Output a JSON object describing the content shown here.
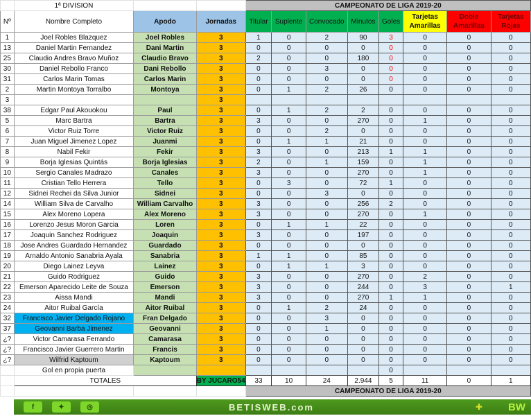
{
  "header": {
    "division": "1ª DIVISION",
    "campeonato": "CAMPEONATO  DE LIGA 2019-20"
  },
  "columns": {
    "no": "Nº",
    "nombre": "Nombre Completo",
    "apodo": "Apodo",
    "jornadas": "Jornadas",
    "titular": "Titular",
    "suplente": "Suplente",
    "convocado": "Convocado",
    "minutos": "Minutos",
    "goles": "Goles",
    "amarillas": "Tarjetas Amarillas",
    "doble": "Doble Amarillas",
    "rojas": "Tarjetas Rojas"
  },
  "players": [
    {
      "no": "1",
      "nombre": "Joel Robles Blazquez",
      "apodo": "Joel Robles",
      "jornadas": "3",
      "stats": [
        "1",
        "0",
        "2",
        "90",
        "3",
        "0",
        "0",
        "0"
      ],
      "goal_red": true
    },
    {
      "no": "13",
      "nombre": "Daniel Martin Fernandez",
      "apodo": "Dani Martin",
      "jornadas": "3",
      "stats": [
        "0",
        "0",
        "0",
        "0",
        "0",
        "0",
        "0",
        "0"
      ],
      "goal_red": true
    },
    {
      "no": "25",
      "nombre": "Claudio Andres Bravo Muñoz",
      "apodo": "Claudio Bravo",
      "jornadas": "3",
      "stats": [
        "2",
        "0",
        "0",
        "180",
        "0",
        "0",
        "0",
        "0"
      ],
      "goal_red": true
    },
    {
      "no": "30",
      "nombre": "Daniel Rebollo Franco",
      "apodo": "Dani  Rebollo",
      "jornadas": "3",
      "stats": [
        "0",
        "0",
        "3",
        "0",
        "0",
        "0",
        "0",
        "0"
      ],
      "goal_red": true
    },
    {
      "no": "31",
      "nombre": "Carlos Marin Tomas",
      "apodo": "Carlos Marin",
      "jornadas": "3",
      "stats": [
        "0",
        "0",
        "0",
        "0",
        "0",
        "0",
        "0",
        "0"
      ],
      "goal_red": true
    },
    {
      "no": "2",
      "nombre": "Martin Montoya Torralbo",
      "apodo": "Montoya",
      "jornadas": "3",
      "stats": [
        "0",
        "1",
        "2",
        "26",
        "0",
        "0",
        "0",
        "0"
      ]
    },
    {
      "no": "3",
      "nombre": "",
      "apodo": "",
      "jornadas": "3",
      "stats": [
        "",
        "",
        "",
        "",
        "",
        "",
        "",
        ""
      ]
    },
    {
      "no": "38",
      "nombre": "Edgar Paul Akouokou",
      "apodo": "Paul",
      "jornadas": "3",
      "stats": [
        "0",
        "1",
        "2",
        "2",
        "0",
        "0",
        "0",
        "0"
      ]
    },
    {
      "no": "5",
      "nombre": "Marc Bartra",
      "apodo": "Bartra",
      "jornadas": "3",
      "stats": [
        "3",
        "0",
        "0",
        "270",
        "0",
        "1",
        "0",
        "0"
      ]
    },
    {
      "no": "6",
      "nombre": "Victor Ruiz Torre",
      "apodo": "Victor Ruiz",
      "jornadas": "3",
      "stats": [
        "0",
        "0",
        "2",
        "0",
        "0",
        "0",
        "0",
        "0"
      ]
    },
    {
      "no": "7",
      "nombre": "Juan Miguel Jimenez Lopez",
      "apodo": "Juanmi",
      "jornadas": "3",
      "stats": [
        "0",
        "1",
        "1",
        "21",
        "0",
        "0",
        "0",
        "0"
      ]
    },
    {
      "no": "8",
      "nombre": "Nabil Fekir",
      "apodo": "Fekir",
      "jornadas": "3",
      "stats": [
        "3",
        "0",
        "0",
        "213",
        "1",
        "1",
        "0",
        "0"
      ]
    },
    {
      "no": "9",
      "nombre": "Borja Iglesias Quintás",
      "apodo": "Borja Iglesias",
      "jornadas": "3",
      "stats": [
        "2",
        "0",
        "1",
        "159",
        "0",
        "1",
        "0",
        "0"
      ]
    },
    {
      "no": "10",
      "nombre": "Sergio Canales Madrazo",
      "apodo": "Canales",
      "jornadas": "3",
      "stats": [
        "3",
        "0",
        "0",
        "270",
        "0",
        "1",
        "0",
        "0"
      ]
    },
    {
      "no": "11",
      "nombre": "Cristian Tello Herrera",
      "apodo": "Tello",
      "jornadas": "3",
      "stats": [
        "0",
        "3",
        "0",
        "72",
        "1",
        "0",
        "0",
        "0"
      ]
    },
    {
      "no": "12",
      "nombre": "Sidnei Rechei da Silva Junior",
      "apodo": "Sidnei",
      "jornadas": "3",
      "stats": [
        "0",
        "0",
        "3",
        "0",
        "0",
        "0",
        "0",
        "0"
      ]
    },
    {
      "no": "14",
      "nombre": "William Silva de Carvalho",
      "apodo": "William Carvalho",
      "jornadas": "3",
      "stats": [
        "3",
        "0",
        "0",
        "256",
        "2",
        "0",
        "0",
        "0"
      ]
    },
    {
      "no": "15",
      "nombre": "Alex Moreno Lopera",
      "apodo": "Alex Moreno",
      "jornadas": "3",
      "stats": [
        "3",
        "0",
        "0",
        "270",
        "0",
        "1",
        "0",
        "0"
      ]
    },
    {
      "no": "16",
      "nombre": "Lorenzo Jesus Moron Garcia",
      "apodo": "Loren",
      "jornadas": "3",
      "stats": [
        "0",
        "1",
        "1",
        "22",
        "0",
        "0",
        "0",
        "0"
      ]
    },
    {
      "no": "17",
      "nombre": "Joaquin Sanchez Rodriguez",
      "apodo": "Joaquin",
      "jornadas": "3",
      "stats": [
        "3",
        "0",
        "0",
        "197",
        "0",
        "0",
        "0",
        "0"
      ]
    },
    {
      "no": "18",
      "nombre": "Jose Andres Guardado Hernandez",
      "apodo": "Guardado",
      "jornadas": "3",
      "stats": [
        "0",
        "0",
        "0",
        "0",
        "0",
        "0",
        "0",
        "0"
      ]
    },
    {
      "no": "19",
      "nombre": "Arnaldo Antonio Sanabria Ayala",
      "apodo": "Sanabria",
      "jornadas": "3",
      "stats": [
        "1",
        "1",
        "0",
        "85",
        "0",
        "0",
        "0",
        "0"
      ]
    },
    {
      "no": "20",
      "nombre": "Diego Lainez Leyva",
      "apodo": "Lainez",
      "jornadas": "3",
      "stats": [
        "0",
        "1",
        "1",
        "3",
        "0",
        "0",
        "0",
        "0"
      ]
    },
    {
      "no": "21",
      "nombre": "Guido Rodriguez",
      "apodo": "Guido",
      "jornadas": "3",
      "stats": [
        "3",
        "0",
        "0",
        "270",
        "0",
        "2",
        "0",
        "0"
      ]
    },
    {
      "no": "22",
      "nombre": "Emerson Aparecido Leite de Souza",
      "apodo": "Emerson",
      "jornadas": "3",
      "stats": [
        "3",
        "0",
        "0",
        "244",
        "0",
        "3",
        "0",
        "1"
      ]
    },
    {
      "no": "23",
      "nombre": "Aissa Mandi",
      "apodo": "Mandi",
      "jornadas": "3",
      "stats": [
        "3",
        "0",
        "0",
        "270",
        "1",
        "1",
        "0",
        "0"
      ]
    },
    {
      "no": "24",
      "nombre": "Aitor Ruibal García",
      "apodo": "Aitor Ruibal",
      "jornadas": "3",
      "stats": [
        "0",
        "1",
        "2",
        "24",
        "0",
        "0",
        "0",
        "0"
      ]
    },
    {
      "no": "32",
      "nombre": "Francisco Javier Delgado Rojano",
      "apodo": "Fran Delgado",
      "jornadas": "3",
      "stats": [
        "0",
        "0",
        "3",
        "0",
        "0",
        "0",
        "0",
        "0"
      ],
      "name_bg": "#00b0f0"
    },
    {
      "no": "37",
      "nombre": "Geovanni Barba Jimenez",
      "apodo": "Geovanni",
      "jornadas": "3",
      "stats": [
        "0",
        "0",
        "1",
        "0",
        "0",
        "0",
        "0",
        "0"
      ],
      "name_bg": "#00b0f0"
    },
    {
      "no": "¿?",
      "nombre": "Victor Camarasa Ferrando",
      "apodo": "Camarasa",
      "jornadas": "3",
      "stats": [
        "0",
        "0",
        "0",
        "0",
        "0",
        "0",
        "0",
        "0"
      ]
    },
    {
      "no": "¿?",
      "nombre": "Francisco Javier Guerrero Martin",
      "apodo": "Francis",
      "jornadas": "3",
      "stats": [
        "0",
        "0",
        "0",
        "0",
        "0",
        "0",
        "0",
        "0"
      ]
    },
    {
      "no": "¿?",
      "nombre": "Wilfrid Kaptoum",
      "apodo": "Kaptoum",
      "jornadas": "3",
      "stats": [
        "0",
        "0",
        "0",
        "0",
        "0",
        "0",
        "0",
        "0"
      ],
      "name_bg": "#d0d0d0"
    }
  ],
  "own_goal": {
    "label": "Gol en propia puerta",
    "goles": "0"
  },
  "totals": {
    "label": "TOTALES",
    "by": "BY JUCARO54",
    "values": [
      "33",
      "10",
      "24",
      "2.944",
      "5",
      "11",
      "0",
      "1"
    ]
  },
  "footer": {
    "campeonato": "CAMPEONATO  DE LIGA 2019-20",
    "brand": "BETISWEB.com",
    "logo": "BW",
    "social": [
      "facebook-icon",
      "twitter-icon",
      "instagram-icon"
    ]
  },
  "colors": {
    "stats_header": "#00b050",
    "amarillas": "#ffff00",
    "rojas": "#ff0000",
    "jornadas": "#ffc000",
    "apodo": "#c6e0b4",
    "stats_cells": "#ddebf7",
    "banner": "#4e9a1e"
  }
}
